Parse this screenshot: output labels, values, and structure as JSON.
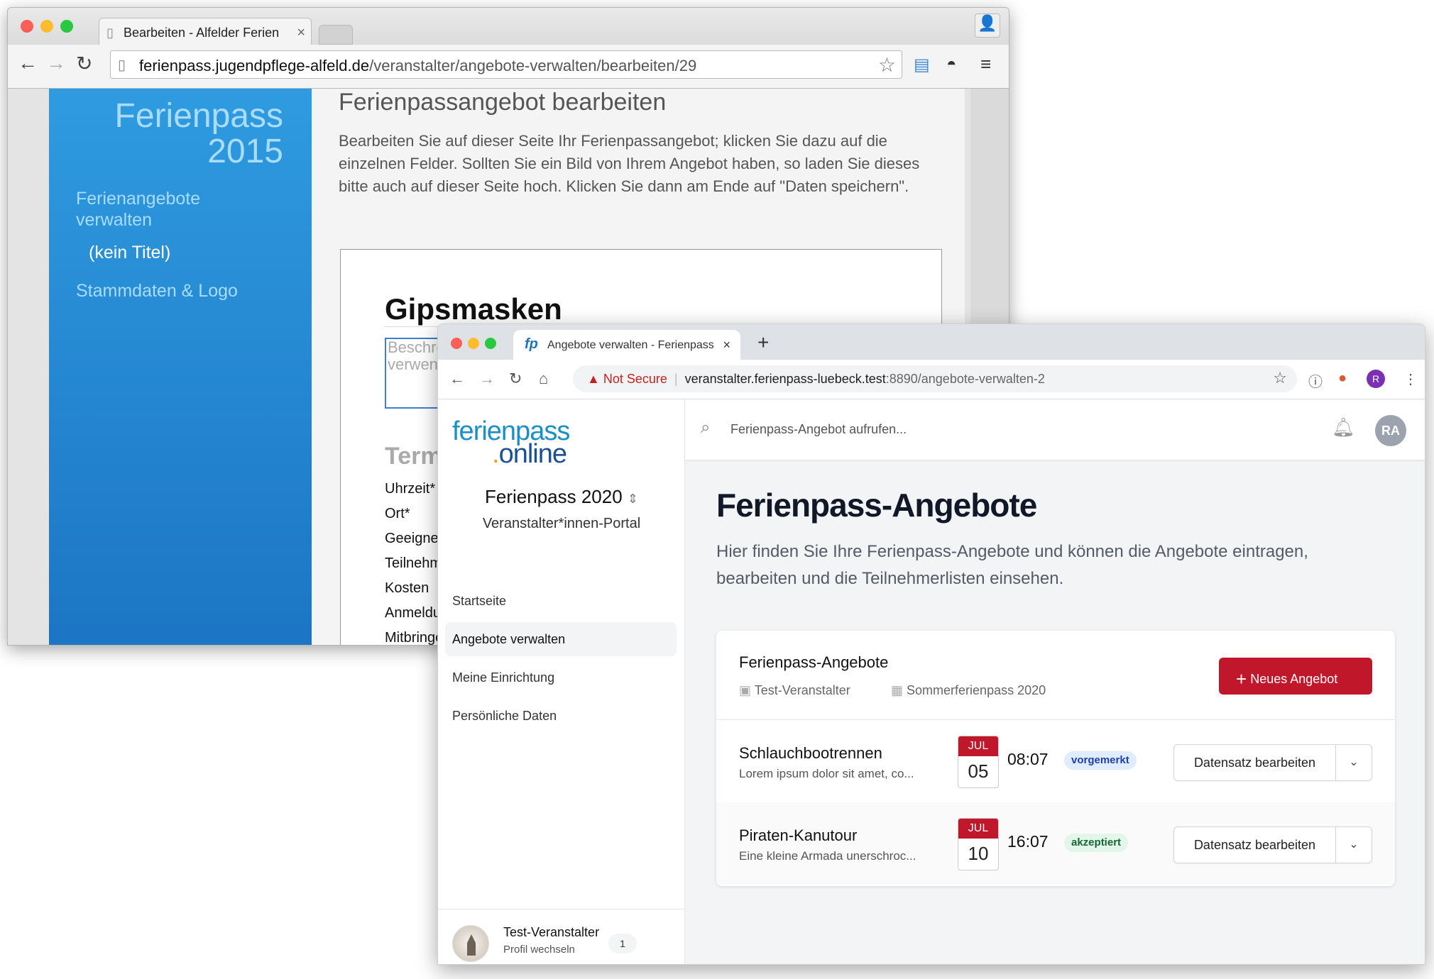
{
  "back": {
    "tab_title": "Bearbeiten - Alfelder Ferien",
    "tab_close": "×",
    "url_domain": "ferienpass.jugendpflege-alfeld.de",
    "url_path": "/veranstalter/angebote-verwalten/bearbeiten/29",
    "brand_line1": "Ferienpass",
    "brand_line2": "2015",
    "nav": [
      "Ferienangebote verwalten",
      "(kein Titel)",
      "Stammdaten & Logo"
    ],
    "heading": "Ferienpassangebot bearbeiten",
    "intro": "Bearbeiten Sie auf dieser Seite Ihr Ferienpassangebot; klicken Sie dazu auf die einzelnen Felder. Sollten Sie ein Bild von Ihrem Angebot haben, so laden Sie dieses bitte auch auf dieser Seite hoch. Klicken Sie dann am Ende auf \"Daten speichern\".",
    "offer_title": "Gipsmasken",
    "desc_placeholder": "Beschreibung verwenden",
    "section": "Termin",
    "fields": [
      "Uhrzeit*",
      "Ort*",
      "Geeignet",
      "Teilnehmer",
      "Kosten",
      "Anmeldung",
      "Mitbringen"
    ]
  },
  "front": {
    "tab_favicon": "fp",
    "tab_title": "Angebote verwalten - Ferienpass",
    "tab_close": "×",
    "new_tab": "+",
    "warning": "Not Secure",
    "url_domain": "veranstalter.ferienpass-luebeck.test",
    "url_path": ":8890/angebote-verwalten-2",
    "profile_initial": "R",
    "logo_line1": "ferienpass",
    "logo_dot": ".",
    "logo_line2": "online",
    "program": "Ferienpass 2020",
    "portal": "Veranstalter*innen-Portal",
    "nav": [
      "Startseite",
      "Angebote verwalten",
      "Meine Einrichtung",
      "Persönliche Daten"
    ],
    "footer_name": "Test-Veranstalter",
    "footer_sub": "Profil wechseln",
    "footer_badge": "1",
    "search_placeholder": "Ferienpass-Angebot aufrufen...",
    "user_initials": "RA",
    "page_title": "Ferienpass-Angebote",
    "page_desc": "Hier finden Sie Ihre Ferienpass-Angebote und können die Angebote eintragen, bearbeiten und die Teilnehmerlisten einsehen.",
    "panel_title": "Ferienpass-Angebote",
    "meta_org": "Test-Veranstalter",
    "meta_program": "Sommerferienpass 2020",
    "new_button": "Neues Angebot",
    "rows": [
      {
        "title": "Schlauchbootrennen",
        "subtitle": "Lorem ipsum dolor sit amet, co...",
        "month": "JUL",
        "day": "05",
        "time": "08:07",
        "status": "vorgemerkt",
        "action": "Datensatz bearbeiten"
      },
      {
        "title": "Piraten-Kanutour",
        "subtitle": "Eine kleine Armada unerschroc...",
        "month": "JUL",
        "day": "10",
        "time": "16:07",
        "status": "akzeptiert",
        "action": "Datensatz bearbeiten"
      }
    ]
  },
  "colors": {
    "accent_red": "#c0172b",
    "brand_blue": "#1b8fc7",
    "legacy_blue": "#2f9be0"
  }
}
